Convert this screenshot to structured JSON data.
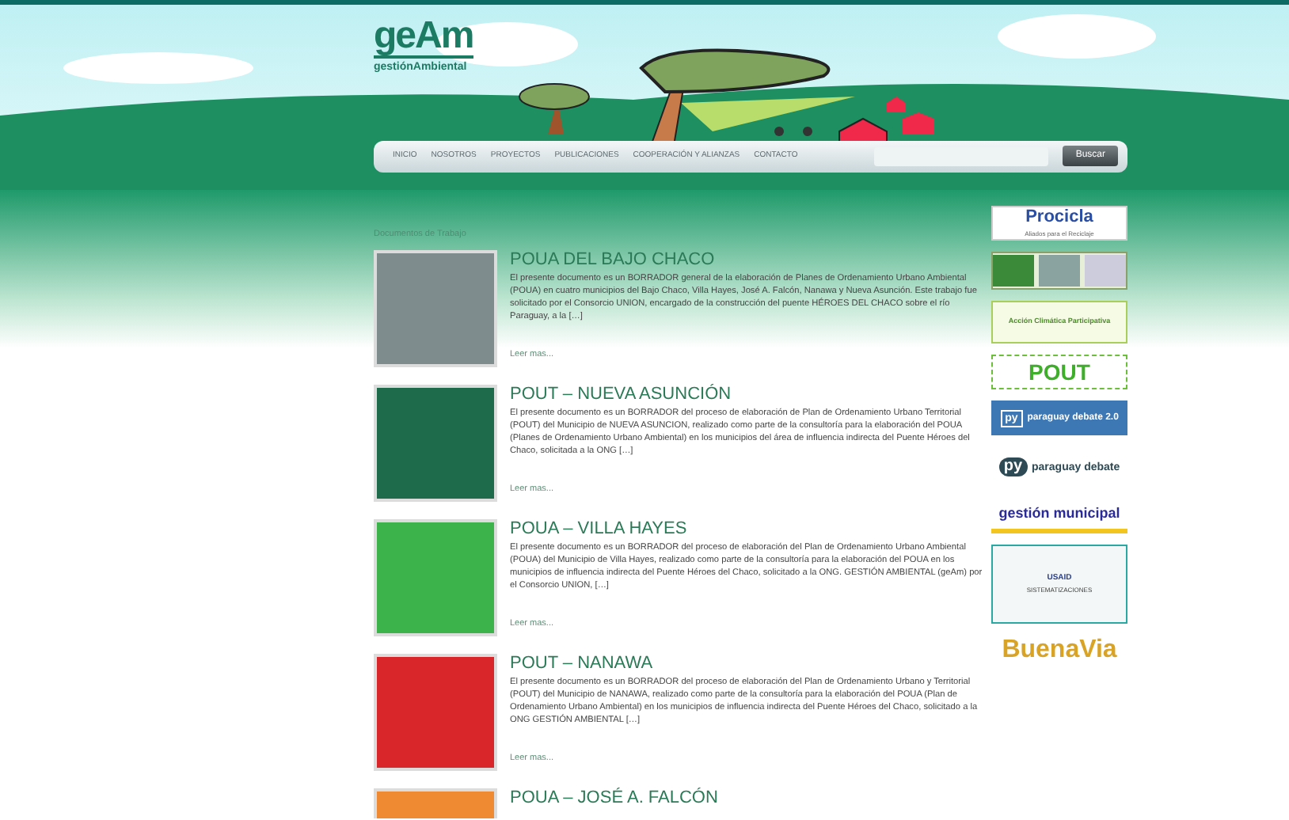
{
  "logo": {
    "mark": "geAm",
    "name": "gestiónAmbiental"
  },
  "nav": {
    "items": [
      {
        "label": "INICIO"
      },
      {
        "label": "NOSOTROS"
      },
      {
        "label": "PROYECTOS"
      },
      {
        "label": "PUBLICACIONES"
      },
      {
        "label": "COOPERACIÓN Y ALIANZAS"
      },
      {
        "label": "CONTACTO"
      }
    ],
    "search_button": "Buscar"
  },
  "section_title": "Documentos de Trabajo",
  "documents": [
    {
      "title": "POUA DEL BAJO CHACO",
      "color": "#7e8c8e",
      "summary": "El presente documento es un BORRADOR general de la elaboración de Planes de Ordenamiento Urbano Ambiental (POUA) en cuatro municipios del Bajo Chaco, Villa Hayes, José A. Falcón, Nanawa y Nueva Asunción. Este trabajo fue solicitado por el Consorcio UNION, encargado de la construcción del puente HÉROES DEL CHACO sobre el río Paraguay, a la […]",
      "more": "Leer mas..."
    },
    {
      "title": "POUT – NUEVA ASUNCIÓN",
      "color": "#1d6b4a",
      "summary": "El presente documento es un BORRADOR del proceso de elaboración de Plan de Ordenamiento Urbano Territorial (POUT) del Municipio de NUEVA ASUNCION, realizado como parte de la consultoría para la elaboración del POUA (Planes de Ordenamiento Urbano Ambiental) en los municipios del área de influencia indirecta del Puente Héroes del Chaco, solicitada a la ONG […]",
      "more": "Leer mas..."
    },
    {
      "title": "POUA – VILLA HAYES",
      "color": "#3db44b",
      "summary": "El presente documento es un BORRADOR del proceso de elaboración del Plan de Ordenamiento Urbano Ambiental (POUA) del Municipio de Villa Hayes, realizado como parte de la consultoría para la elaboración del POUA en los municipios de influencia indirecta del Puente Héroes del Chaco, solicitado a la ONG. GESTIÓN AMBIENTAL (geAm) por el Consorcio UNION, […]",
      "more": "Leer mas..."
    },
    {
      "title": "POUT – NANAWA",
      "color": "#d8262b",
      "summary": "El presente documento es un BORRADOR del proceso de elaboración del Plan de Ordenamiento Urbano y Territorial (POUT) del Municipio de NANAWA, realizado como parte de la consultoría para la elaboración del POUA (Plan de Ordenamiento Urbano Ambiental) en los municipios de influencia indirecta del Puente Héroes del Chaco, solicitado a la ONG GESTIÓN AMBIENTAL […]",
      "more": "Leer mas..."
    },
    {
      "title": "POUA – JOSÉ A. FALCÓN",
      "color": "#ef8a32"
    }
  ],
  "partners": [
    {
      "kind": "procicla",
      "texts": [
        "Procicla",
        "Aliados para el Reciclaje"
      ]
    },
    {
      "kind": "flags"
    },
    {
      "kind": "accion",
      "texts": [
        "Acción Climática Participativa"
      ]
    },
    {
      "kind": "pout",
      "texts": [
        "POUT"
      ]
    },
    {
      "kind": "pydebate20",
      "texts": [
        "py",
        "paraguay debate 2.0"
      ]
    },
    {
      "kind": "pydebate",
      "texts": [
        "py",
        "paraguay debate"
      ]
    },
    {
      "kind": "gestion",
      "texts": [
        "gestión municipal"
      ]
    },
    {
      "kind": "report",
      "texts": [
        "USAID",
        "SISTEMATIZACIONES"
      ]
    },
    {
      "kind": "buenavia",
      "texts": [
        "BuenaVia"
      ]
    }
  ]
}
